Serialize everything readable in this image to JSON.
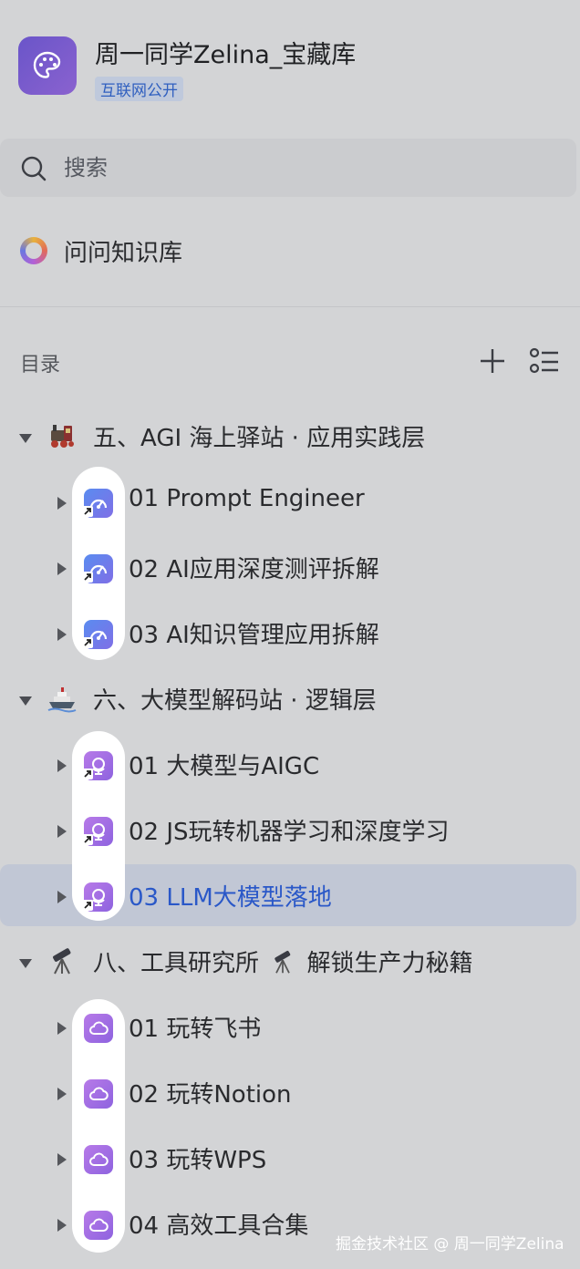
{
  "header": {
    "title": "周一同学Zelina_宝藏库",
    "badge": "互联网公开",
    "logo_icon": "palette-icon",
    "logo_color": "#7a5ccc"
  },
  "search": {
    "placeholder": "搜索",
    "value": ""
  },
  "knowledge_base": {
    "label": "问问知识库",
    "icon": "ring-gradient-icon"
  },
  "toc": {
    "label": "目录",
    "add_icon": "plus-icon",
    "list_icon": "list-icon"
  },
  "sections": [
    {
      "title": "五、AGI 海上驿站 · 应用实践层",
      "emoji_icon": "train-icon",
      "items": [
        {
          "label": "01 Prompt Engineer",
          "icon": "gauge-icon"
        },
        {
          "label": "02 AI应用深度测评拆解",
          "icon": "gauge-icon"
        },
        {
          "label": "03 AI知识管理应用拆解",
          "icon": "gauge-icon"
        }
      ]
    },
    {
      "title": "六、大模型解码站 · 逻辑层",
      "emoji_icon": "ship-icon",
      "items": [
        {
          "label": "01 大模型与AIGC",
          "icon": "globe-stand-icon"
        },
        {
          "label": "02 JS玩转机器学习和深度学习",
          "icon": "globe-stand-icon"
        },
        {
          "label": "03 LLM大模型落地",
          "icon": "globe-stand-icon",
          "active": true
        }
      ]
    },
    {
      "title_parts": [
        "八、工具研究所",
        "解锁生产力秘籍"
      ],
      "emoji_icon": "telescope-icon",
      "items": [
        {
          "label": "01 玩转飞书",
          "icon": "cloud-icon"
        },
        {
          "label": "02 玩转Notion",
          "icon": "cloud-icon"
        },
        {
          "label": "03 玩转WPS",
          "icon": "cloud-icon"
        },
        {
          "label": "04 高效工具合集",
          "icon": "cloud-icon"
        }
      ]
    }
  ],
  "watermark": "掘金技术社区 @ 周一同学Zelina",
  "colors": {
    "active_text": "#2a58c8",
    "active_bg": "#c1c7d5",
    "badge_text": "#2f5fbf"
  }
}
